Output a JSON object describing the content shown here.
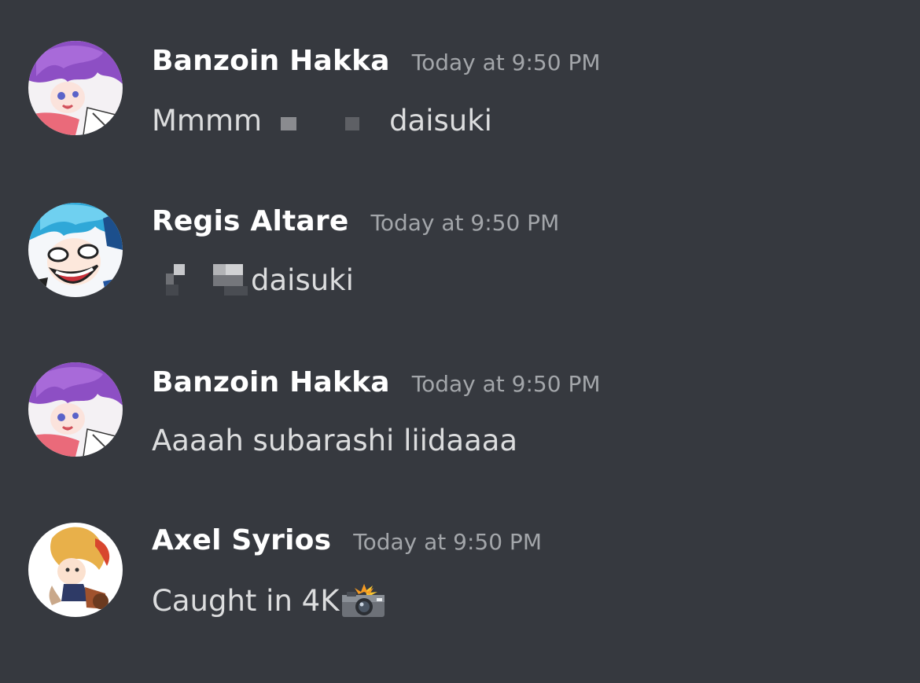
{
  "colors": {
    "background": "#36393f",
    "username": "#ffffff",
    "timestamp": "#a3a6aa",
    "message_text": "#dcddde"
  },
  "messages": [
    {
      "username": "Banzoin Hakka",
      "timestamp": "Today at 9:50 PM",
      "text_before": "Mmmm",
      "text_after": "daisuki",
      "avatar_icon": "purple-haired-avatar"
    },
    {
      "username": "Regis Altare",
      "timestamp": "Today at 9:50 PM",
      "text_after": "daisuki",
      "avatar_icon": "blue-haired-avatar"
    },
    {
      "username": "Banzoin Hakka",
      "timestamp": "Today at 9:50 PM",
      "text": "Aaaah subarashi liidaaaa",
      "avatar_icon": "purple-haired-avatar"
    },
    {
      "username": "Axel Syrios",
      "timestamp": "Today at 9:50 PM",
      "text": "Caught in 4K",
      "emoji": "camera-flash-emoji",
      "avatar_icon": "blonde-haired-avatar"
    }
  ]
}
